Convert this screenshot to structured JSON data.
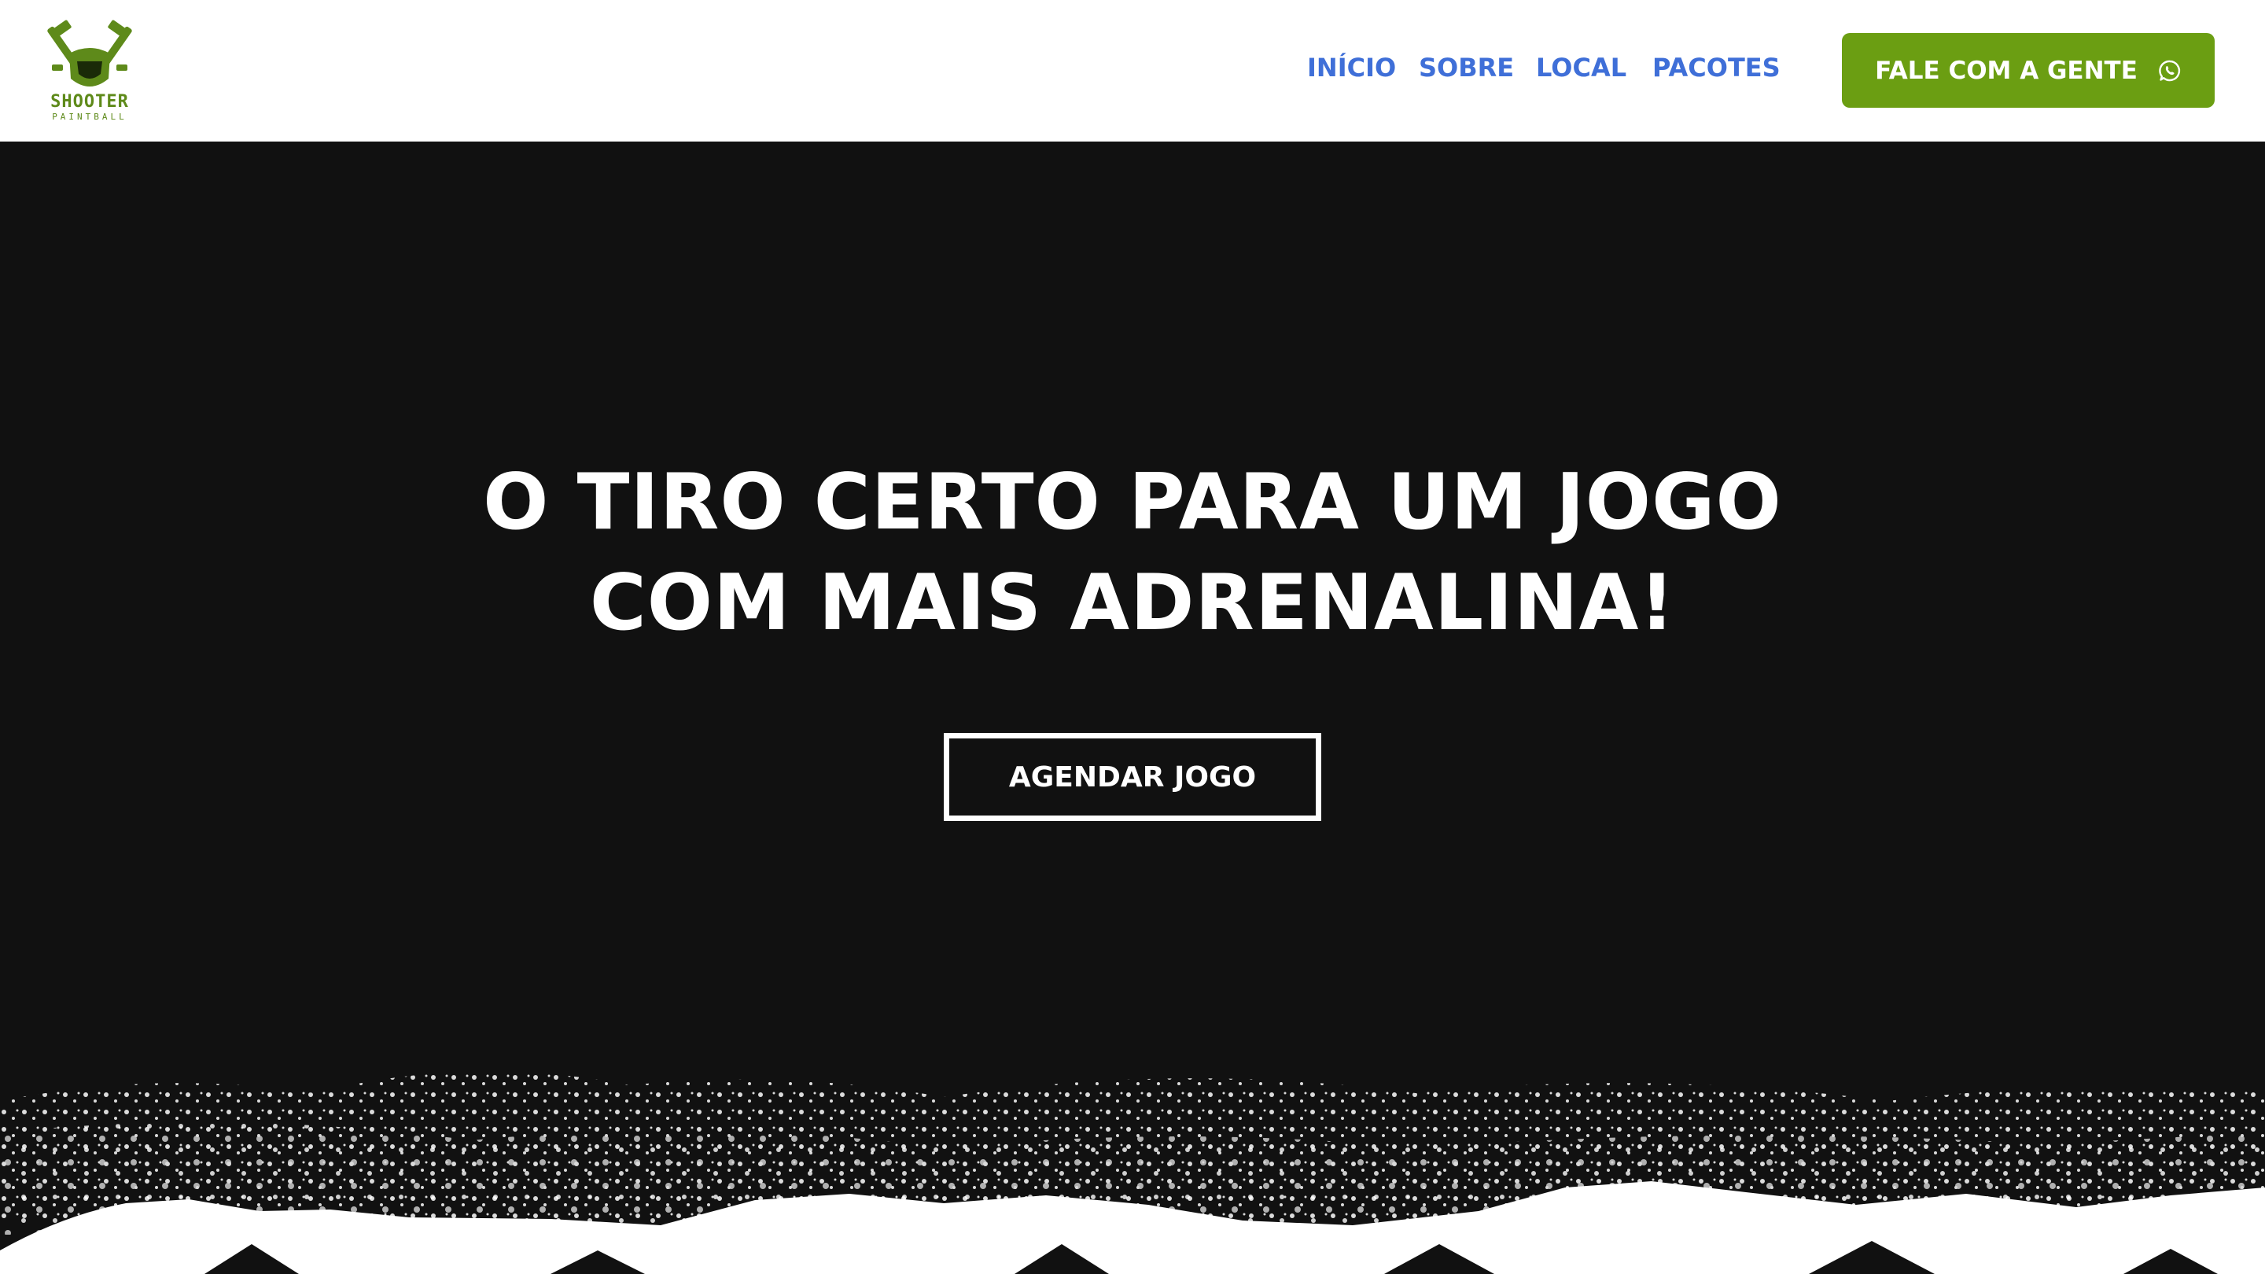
{
  "brand": {
    "logo_line1": "SHOOTER",
    "logo_line2": "PAINTBALL",
    "logo_color": "#5e8a1a"
  },
  "nav": {
    "items": [
      {
        "label": "INÍCIO"
      },
      {
        "label": "SOBRE"
      },
      {
        "label": "LOCAL"
      },
      {
        "label": "PACOTES"
      }
    ],
    "color": "#3f6fd8"
  },
  "header_cta": {
    "label": "FALE COM A GENTE",
    "icon": "whatsapp-icon",
    "color": "#6b9e12"
  },
  "hero": {
    "headline_line1": "O TIRO CERTO PARA UM JOGO",
    "headline_line2": "COM MAIS ADRENALINA!",
    "cta_label": "AGENDAR JOGO",
    "background": "#111111"
  }
}
